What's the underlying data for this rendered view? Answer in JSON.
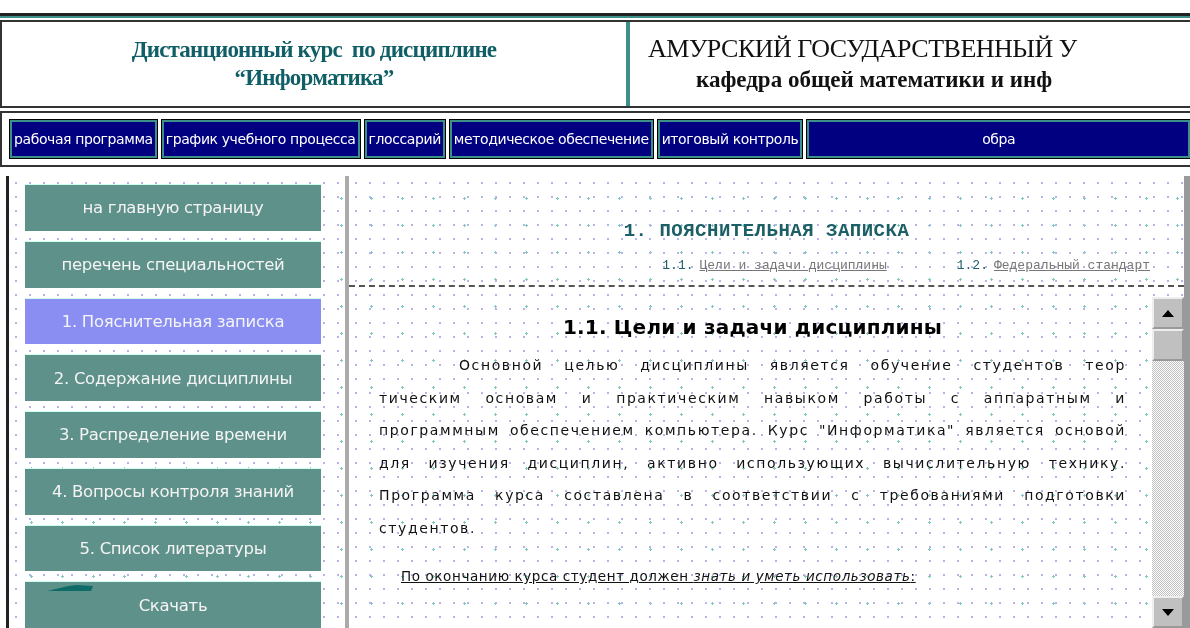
{
  "header": {
    "course_lines": [
      "Дистанционный курс  по дисциплине",
      "“Информатика”"
    ],
    "university": "АМУРСКИЙ ГОСУДАРСТВЕННЫЙ У",
    "department": "кафедра общей математики и инф"
  },
  "nav": [
    {
      "label": "рабочая программа"
    },
    {
      "label": "график учебного процесса"
    },
    {
      "label": "глоссарий"
    },
    {
      "label": "методическое обеспечение"
    },
    {
      "label": "итоговый контроль"
    },
    {
      "label": "обра"
    }
  ],
  "sidebar": [
    {
      "label": "на главную страницу",
      "selected": false,
      "kind": "link"
    },
    {
      "label": "перечень специальностей",
      "selected": false,
      "kind": "link"
    },
    {
      "label": "1. Пояснительная записка",
      "selected": true,
      "kind": "link"
    },
    {
      "label": "2. Содержание дисциплины",
      "selected": false,
      "kind": "link"
    },
    {
      "label": "3. Распределение времени",
      "selected": false,
      "kind": "link"
    },
    {
      "label": "4. Вопросы контроля знаний",
      "selected": false,
      "kind": "link"
    },
    {
      "label": "5. Список литературы",
      "selected": false,
      "kind": "link"
    },
    {
      "label": "Скачать",
      "selected": false,
      "kind": "download"
    }
  ],
  "section": {
    "heading": "1. ПОЯСНИТЕЛЬНАЯ ЗАПИСКА",
    "links": [
      {
        "number": "1.1.",
        "label": "Цели и задачи дисциплины"
      },
      {
        "number": "1.2.",
        "label": "Федеральный стандарт"
      }
    ],
    "subheading": "1.1. Цели и задачи дисциплины",
    "paragraph": "Основной целью дисциплины является обучение студентов теор тическим основам и практическим навыком работы с аппаратным и программным обеспечением компьютера. Курс \"Информатика\" является основой  для изучения дисциплин, активно использующих вычислительную технику. Программа курса составлена в соответствии с требованиями подготовки студентов.",
    "note": "По окончанию курса студент должен *знать и уметь использовать*:"
  }
}
